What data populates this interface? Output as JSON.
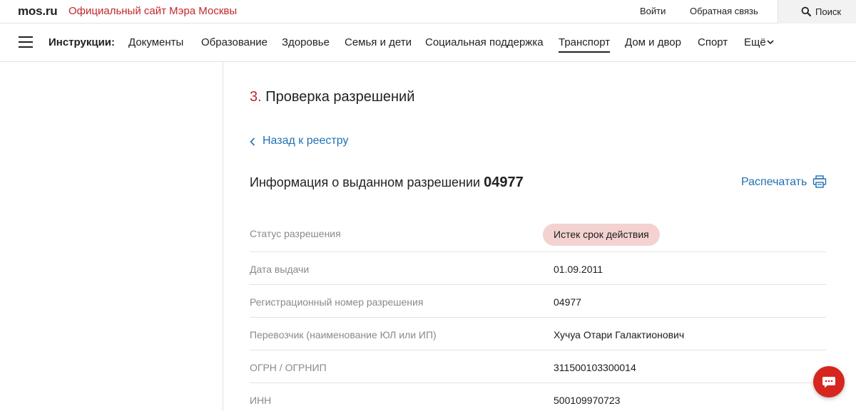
{
  "topbar": {
    "logo": "mos.ru",
    "site_title": "Официальный сайт Мэра Москвы",
    "login": "Войти",
    "feedback": "Обратная связь",
    "search": "Поиск"
  },
  "nav": {
    "heading": "Инструкции:",
    "items": [
      {
        "label": "Документы"
      },
      {
        "label": "Образование"
      },
      {
        "label": "Здоровье"
      },
      {
        "label": "Семья и дети"
      },
      {
        "label": "Социальная поддержка"
      },
      {
        "label": "Транспорт",
        "active": true
      },
      {
        "label": "Дом и двор"
      },
      {
        "label": "Спорт"
      },
      {
        "label": "Ещё"
      }
    ]
  },
  "content": {
    "step_number": "3.",
    "step_title": "Проверка разрешений",
    "back_link": "Назад к реестру",
    "info_title": "Информация о выданном разрешении",
    "info_number": "04977",
    "print": "Распечатать",
    "rows": [
      {
        "label": "Статус разрешения",
        "value": "Истек срок действия"
      },
      {
        "label": "Дата выдачи",
        "value": "01.09.2011"
      },
      {
        "label": "Регистрационный номер разрешения",
        "value": "04977"
      },
      {
        "label": "Перевозчик (наименование ЮЛ или ИП)",
        "value": "Хучуа Отари Галактионович"
      },
      {
        "label": "ОГРН / ОГРНИП",
        "value": "311500103300014"
      },
      {
        "label": "ИНН",
        "value": "500109970723"
      }
    ]
  },
  "colors": {
    "brand_red": "#c0272d",
    "link_blue": "#2271b3",
    "status_badge_bg": "#f4d2d2",
    "chat_red": "#d7261e"
  },
  "icons": [
    "search-icon",
    "menu-icon",
    "chevron-down-icon",
    "chevron-left-icon",
    "printer-icon",
    "chat-icon"
  ]
}
